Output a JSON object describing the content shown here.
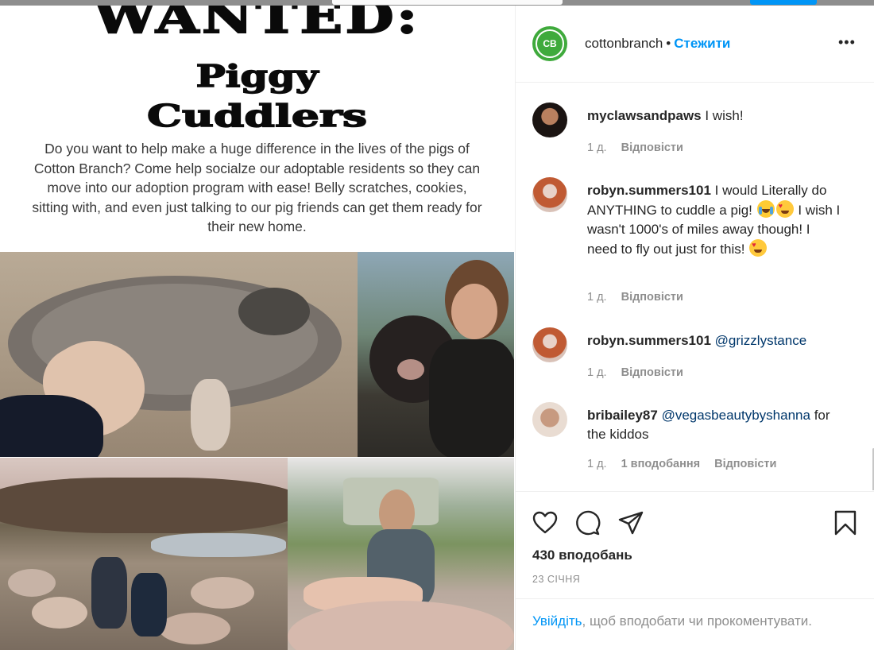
{
  "poster": {
    "title": "WANTED:",
    "subtitle1": "Piggy",
    "subtitle2": "Cuddlers",
    "description": "Do you want to help make a huge difference in the lives of the pigs of Cotton Branch? Come help socialze our adoptable residents so they can move into our adoption program with ease! Belly scratches, cookies, sitting with, and even just talking to our pig friends can get them ready for their new home."
  },
  "header": {
    "username": "cottonbranch",
    "separator": "•",
    "follow_label": "Стежити",
    "more_label": "•••"
  },
  "comments": [
    {
      "user": "myclawsandpaws",
      "text": "I wish!",
      "time": "1 д.",
      "reply": "Відповісти"
    },
    {
      "user": "robyn.summers101",
      "text_a": "I would Literally do ANYTHING to cuddle a pig!",
      "text_b": "I wish I wasn't 1000's of miles away though! I need to fly out just for this!",
      "time": "1 д.",
      "reply": "Відповісти"
    },
    {
      "user": "robyn.summers101",
      "mention": "@grizzlystance",
      "time": "1 д.",
      "reply": "Відповісти"
    },
    {
      "user": "bribailey87",
      "mention": "@vegasbeautybyshanna",
      "text": "for the kiddos",
      "time": "1 д.",
      "likes": "1 вподобання",
      "reply": "Відповісти"
    }
  ],
  "actions": {
    "likes_count": "430 вподобань",
    "date": "23 СІЧНЯ"
  },
  "login": {
    "link": "Увійдіть",
    "text": ", щоб вподобати чи прокоментувати."
  },
  "colors": {
    "accent": "#0095f6",
    "mention": "#00376b",
    "muted": "#8e8e8e",
    "brand_green": "#3faa3c"
  },
  "icons": [
    "heart-icon",
    "comment-icon",
    "share-icon",
    "bookmark-icon",
    "more-icon"
  ]
}
